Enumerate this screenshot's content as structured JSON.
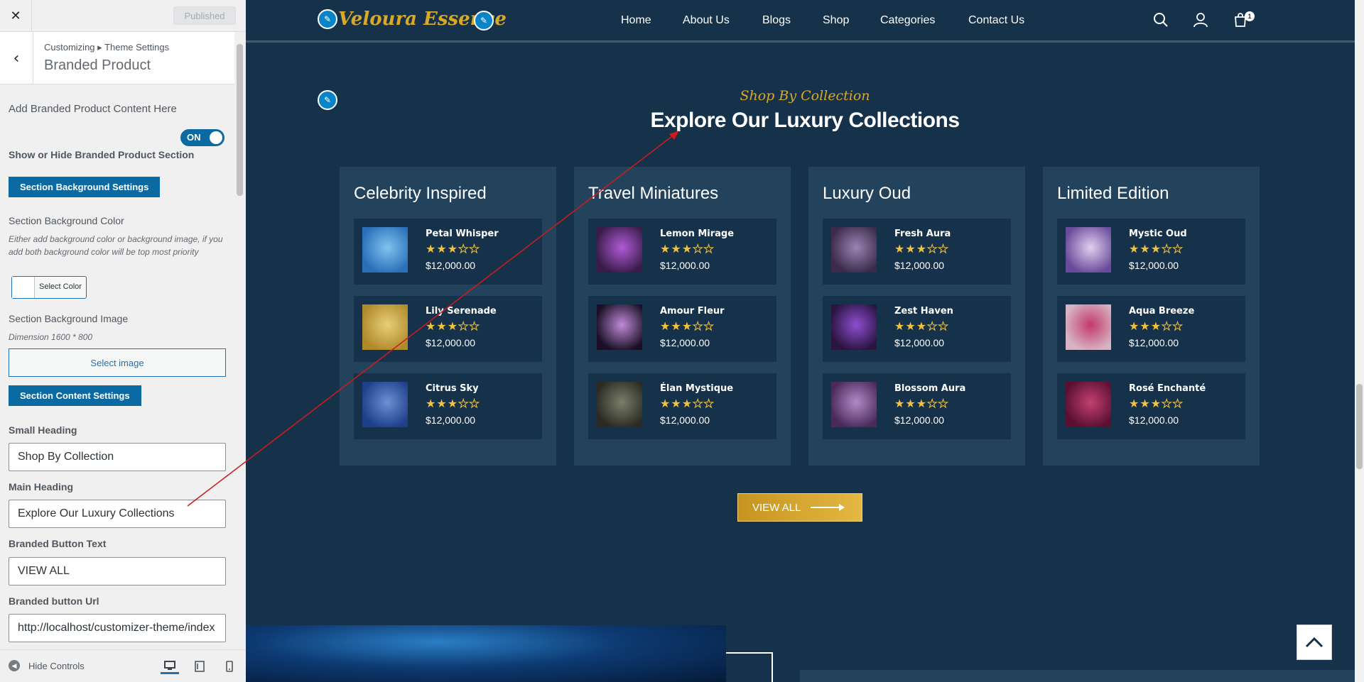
{
  "panel": {
    "published_label": "Published",
    "breadcrumb": "Customizing ▸ Theme Settings",
    "section_title": "Branded Product",
    "intro_title": "Add Branded Product Content Here",
    "toggle_label": "ON",
    "show_hide_label": "Show or Hide Branded Product Section",
    "bg_settings_button": "Section Background Settings",
    "bg_color_label": "Section Background Color",
    "bg_color_desc": "Either add background color or background image, if you add both background color will be top most priority",
    "select_color_label": "Select Color",
    "bg_image_label": "Section Background Image",
    "bg_image_desc": "Dimension 1600 * 800",
    "select_image_label": "Select image",
    "content_settings_button": "Section Content Settings",
    "small_heading_label": "Small Heading",
    "small_heading_value": "Shop By Collection",
    "main_heading_label": "Main Heading",
    "main_heading_value": "Explore Our Luxury Collections",
    "button_text_label": "Branded Button Text",
    "button_text_value": "VIEW ALL",
    "button_url_label": "Branded button Url",
    "button_url_value": "http://localhost/customizer-theme/index",
    "hide_controls_label": "Hide Controls"
  },
  "site": {
    "logo_text": "Veloura Essence",
    "nav": [
      "Home",
      "About Us",
      "Blogs",
      "Shop",
      "Categories",
      "Contact Us"
    ],
    "cart_count": "1",
    "small_heading": "Shop By Collection",
    "main_heading": "Explore Our Luxury Collections",
    "view_all_label": "VIEW ALL",
    "collections": [
      {
        "title": "Celebrity Inspired",
        "products": [
          {
            "name": "Petal Whisper",
            "price": "$12,000.00",
            "rating": 3,
            "colors": [
              "#2a6fb8",
              "#7fc4f0"
            ]
          },
          {
            "name": "Lily Serenade",
            "price": "$12,000.00",
            "rating": 3,
            "colors": [
              "#b08a2a",
              "#e8cf7a"
            ]
          },
          {
            "name": "Citrus Sky",
            "price": "$12,000.00",
            "rating": 3,
            "colors": [
              "#1e3f8a",
              "#6d8fd4"
            ]
          }
        ]
      },
      {
        "title": "Travel Miniatures",
        "products": [
          {
            "name": "Lemon Mirage",
            "price": "$12,000.00",
            "rating": 3,
            "colors": [
              "#3a1c4a",
              "#b05bd6"
            ]
          },
          {
            "name": "Amour Fleur",
            "price": "$12,000.00",
            "rating": 3,
            "colors": [
              "#1a1025",
              "#c08ad8"
            ]
          },
          {
            "name": "Élan Mystique",
            "price": "$12,000.00",
            "rating": 3,
            "colors": [
              "#2b2b24",
              "#7a7f6a"
            ]
          }
        ]
      },
      {
        "title": "Luxury Oud",
        "products": [
          {
            "name": "Fresh Aura",
            "price": "$12,000.00",
            "rating": 3,
            "colors": [
              "#3b2a4a",
              "#9a84b4"
            ]
          },
          {
            "name": "Zest Haven",
            "price": "$12,000.00",
            "rating": 3,
            "colors": [
              "#2a1440",
              "#8e4ed0"
            ]
          },
          {
            "name": "Blossom Aura",
            "price": "$12,000.00",
            "rating": 3,
            "colors": [
              "#4a2a5a",
              "#b28ac8"
            ]
          }
        ]
      },
      {
        "title": "Limited Edition",
        "products": [
          {
            "name": "Mystic Oud",
            "price": "$12,000.00",
            "rating": 3,
            "colors": [
              "#6a4a9a",
              "#e0d0f0"
            ]
          },
          {
            "name": "Aqua Breeze",
            "price": "$12,000.00",
            "rating": 3,
            "colors": [
              "#d7b4c4",
              "#c23a6a"
            ]
          },
          {
            "name": "Rosé Enchanté",
            "price": "$12,000.00",
            "rating": 3,
            "colors": [
              "#5a1030",
              "#c24070"
            ]
          }
        ]
      }
    ]
  },
  "colors": {
    "accent_gold": "#d8a928",
    "site_bg": "#16324a",
    "card_bg": "#23425c",
    "wp_blue": "#0b6aa2",
    "annotation_red": "#d11a1a"
  }
}
